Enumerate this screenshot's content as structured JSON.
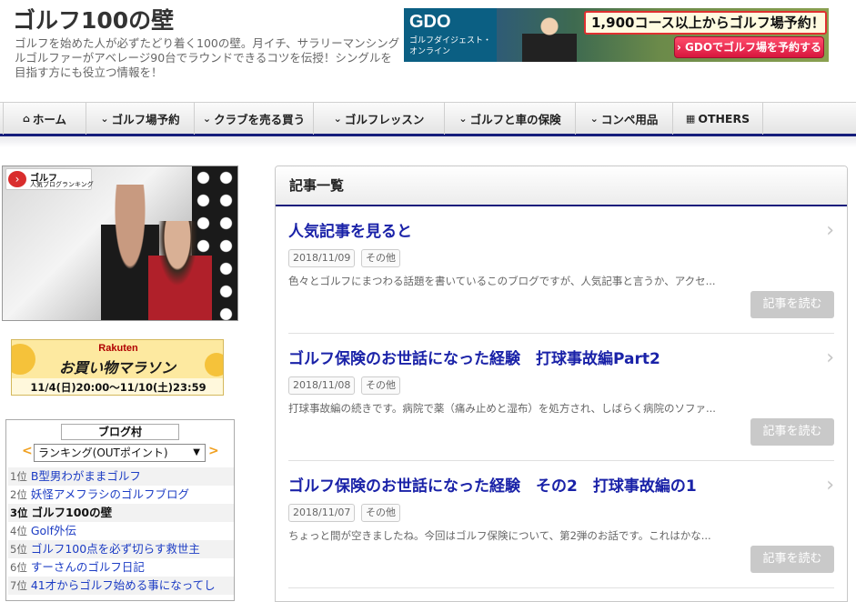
{
  "site": {
    "title": "ゴルフ100の壁",
    "description": "ゴルフを始めた人が必ずたどり着く100の壁。月イチ、サラリーマンシングルゴルファーがアベレージ90台でラウンドできるコツを伝授！シングルを目指す方にも役立つ情報を！"
  },
  "banner_gdo": {
    "logo": "GDO",
    "sub": "ゴルフダイジェスト・オンライン",
    "headline": "1,900コース以上からゴルフ場予約！",
    "cta": "› GDOでゴルフ場を予約する"
  },
  "nav": [
    {
      "label": "ホーム",
      "icon": "home-icon",
      "glyph": "⌂"
    },
    {
      "label": "ゴルフ場予約",
      "icon": "chevron-down-icon",
      "glyph": "⌄"
    },
    {
      "label": "クラブを売る買う",
      "icon": "chevron-down-icon",
      "glyph": "⌄"
    },
    {
      "label": "ゴルフレッスン",
      "icon": "chevron-down-icon",
      "glyph": "⌄"
    },
    {
      "label": "ゴルフと車の保険",
      "icon": "chevron-down-icon",
      "glyph": "⌄"
    },
    {
      "label": "コンペ用品",
      "icon": "chevron-down-icon",
      "glyph": "⌄"
    },
    {
      "label": "OTHERS",
      "icon": "grid-icon",
      "glyph": "▦"
    }
  ],
  "sidebar": {
    "badge_line1": "ゴルフ",
    "badge_line2": "人気ブログランキング",
    "rakuten": {
      "logo": "Rakuten",
      "title": "お買い物マラソン",
      "date": "11/4(日)20:00〜11/10(土)23:59"
    },
    "ranking": {
      "logo": "ブログ村",
      "prev": "<",
      "next": ">",
      "select": "ランキング(OUTポイント)",
      "items": [
        {
          "rank": "1位",
          "title": "B型男わがままゴルフ"
        },
        {
          "rank": "2位",
          "title": "妖怪アメフラシのゴルフブログ"
        },
        {
          "rank": "3位",
          "title": "ゴルフ100の壁",
          "current": true
        },
        {
          "rank": "4位",
          "title": "Golf外伝"
        },
        {
          "rank": "5位",
          "title": "ゴルフ100点を必ず切らす救世主"
        },
        {
          "rank": "6位",
          "title": "すーさんのゴルフ日記"
        },
        {
          "rank": "7位",
          "title": "41才からゴルフ始める事になってし"
        }
      ]
    }
  },
  "main": {
    "heading": "記事一覧",
    "entries": [
      {
        "title": "人気記事を見ると",
        "date": "2018/11/09",
        "category": "その他",
        "excerpt": "色々とゴルフにまつわる話題を書いているこのブログですが、人気記事と言うか、アクセ...",
        "button": "記事を読む"
      },
      {
        "title": "ゴルフ保険のお世話になった経験　打球事故編Part2",
        "date": "2018/11/08",
        "category": "その他",
        "excerpt": "打球事故編の続きです。病院で薬（痛み止めと湿布）を処方され、しばらく病院のソファ...",
        "button": "記事を読む"
      },
      {
        "title": "ゴルフ保険のお世話になった経験　その2　打球事故編の1",
        "date": "2018/11/07",
        "category": "その他",
        "excerpt": "ちょっと間が空きましたね。今回はゴルフ保険について、第2弾のお話です。これはかな...",
        "button": "記事を読む"
      }
    ]
  }
}
